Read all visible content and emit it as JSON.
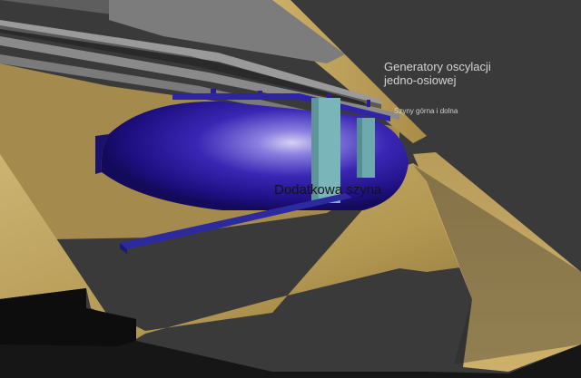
{
  "labels": {
    "oscillation_generators_line1": "Generatory oscylacji",
    "oscillation_generators_line2": "jedno-osiowej",
    "rails": "Szyny górna i dolna",
    "extra_rail": "Dodatkowa szyna"
  },
  "colors": {
    "background": "#3a3a3a",
    "floor_gold": "#b59a58",
    "hull_blue": "#2a1a9a",
    "rail_gray": "#8a8a8a",
    "generator_cyan": "#7ab6b9",
    "extra_rail_blue": "#2d2aa0",
    "shadow_black": "#121212"
  }
}
